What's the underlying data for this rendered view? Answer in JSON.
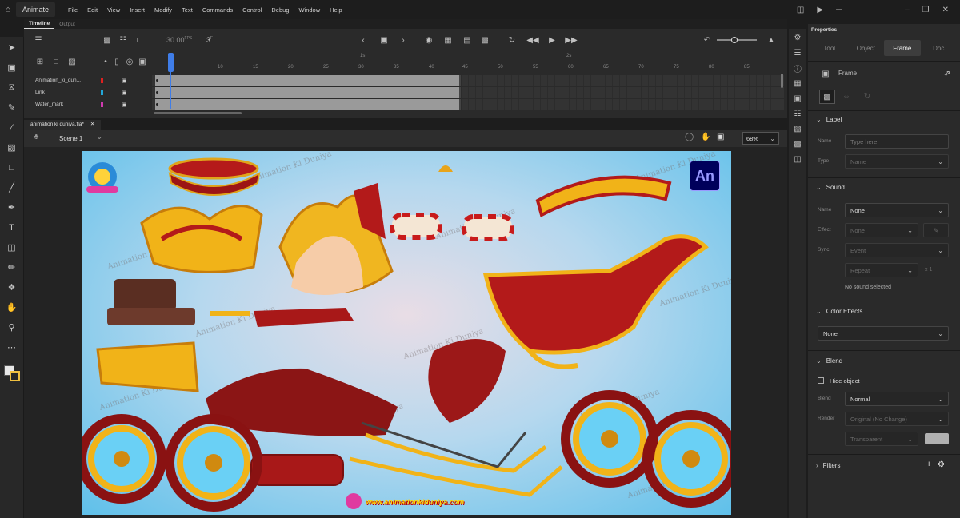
{
  "app": {
    "name": "Animate"
  },
  "menu": [
    "File",
    "Edit",
    "View",
    "Insert",
    "Modify",
    "Text",
    "Commands",
    "Control",
    "Debug",
    "Window",
    "Help"
  ],
  "timeline": {
    "tabs": [
      "Timeline",
      "Output"
    ],
    "fps": "30.00",
    "fps_unit": "FPS",
    "current_frame": "3",
    "frame_unit": "F",
    "ruler_ticks": [
      "5",
      "10",
      "15",
      "20",
      "25",
      "30",
      "35",
      "40",
      "45",
      "50",
      "55",
      "60",
      "65",
      "70",
      "75",
      "80",
      "85"
    ],
    "ruler_markers": [
      "1s",
      "2s"
    ],
    "layers": [
      {
        "name": "Animation_ki_dun...",
        "color": "#e02020"
      },
      {
        "name": "Link",
        "color": "#22a7d8"
      },
      {
        "name": "Water_mark",
        "color": "#d03ab0"
      }
    ]
  },
  "document": {
    "tab_title": "animation ki duniya.fla*",
    "scene": "Scene 1",
    "zoom": "68%",
    "watermark_text": "Animation Ki Duniya",
    "badge": "An",
    "footer_url": "www.animationkiduniya.com"
  },
  "properties": {
    "title": "Properties",
    "tabs": [
      "Tool",
      "Object",
      "Frame",
      "Doc"
    ],
    "active_tab": "Frame",
    "frame_heading": "Frame",
    "label": {
      "heading": "Label",
      "name_label": "Name",
      "name_placeholder": "Type here",
      "type_label": "Type",
      "type_value": "Name"
    },
    "sound": {
      "heading": "Sound",
      "name_label": "Name",
      "name_value": "None",
      "effect_label": "Effect",
      "effect_value": "None",
      "sync_label": "Sync",
      "sync_value": "Event",
      "repeat_value": "Repeat",
      "repeat_count": "x 1",
      "status": "No sound selected"
    },
    "color_effects": {
      "heading": "Color Effects",
      "value": "None"
    },
    "blend": {
      "heading": "Blend",
      "hide_object": "Hide object",
      "blend_label": "Blend",
      "blend_value": "Normal",
      "render_label": "Render",
      "render_value": "Original (No Change)",
      "bg_value": "Transparent"
    },
    "filters": {
      "heading": "Filters"
    }
  }
}
